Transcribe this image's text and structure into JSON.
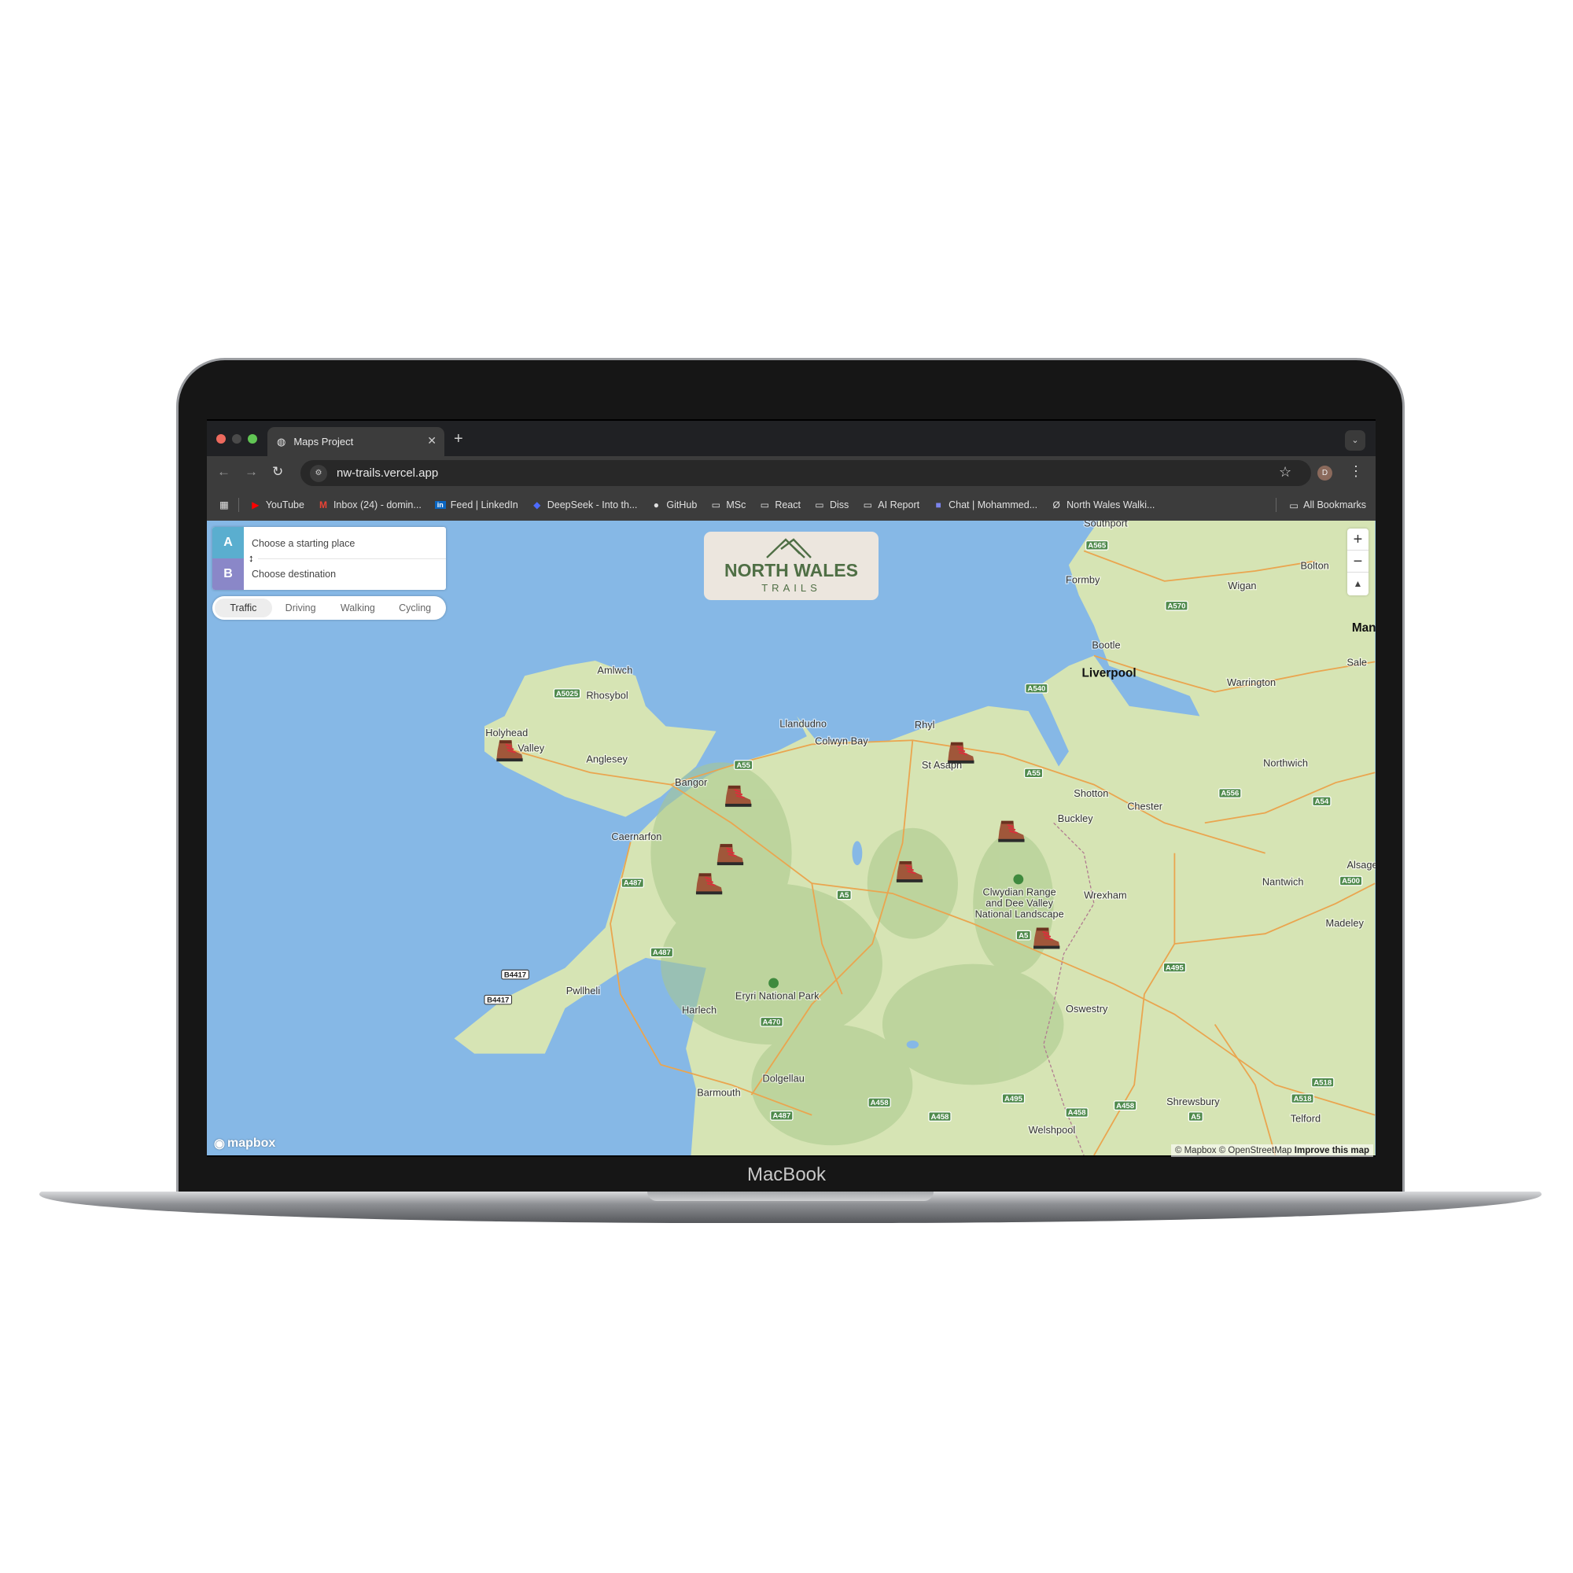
{
  "browser": {
    "tab_title": "Maps Project",
    "url": "nw-trails.vercel.app",
    "avatar_initial": "D",
    "bookmarks": [
      "YouTube",
      "Inbox (24) - domin...",
      "Feed | LinkedIn",
      "DeepSeek - Into th...",
      "GitHub",
      "MSc",
      "React",
      "Diss",
      "AI Report",
      "Chat | Mohammed...",
      "North Wales Walki..."
    ],
    "all_bookmarks": "All Bookmarks"
  },
  "directions": {
    "a_label": "A",
    "b_label": "B",
    "start_placeholder": "Choose a starting place",
    "dest_placeholder": "Choose destination",
    "modes": [
      "Traffic",
      "Driving",
      "Walking",
      "Cycling"
    ],
    "active_mode": "Traffic"
  },
  "logo": {
    "title": "NORTH WALES",
    "subtitle": "TRAILS"
  },
  "map": {
    "labels": [
      "Amlwch",
      "Rhosybol",
      "Holyhead",
      "Valley",
      "Anglesey",
      "Bangor",
      "Llandudno",
      "Colwyn Bay",
      "Rhyl",
      "St Asaph",
      "Caernarfon",
      "Bootle",
      "Southport",
      "Formby",
      "Wigan",
      "Bolton",
      "Sale",
      "Warrington",
      "Northwich",
      "Shotton",
      "Chester",
      "Buckley",
      "Wrexham",
      "Nantwich",
      "Alsager",
      "Madeley",
      "Oswestry",
      "Eryri National Park",
      "Harlech",
      "Pwllheli",
      "Dolgellau",
      "Barmouth",
      "Shrewsbury",
      "Welshpool",
      "Telford"
    ],
    "major_labels": [
      "Liverpool",
      "Man"
    ],
    "park_label": [
      "Clwydian Range",
      "and Dee Valley",
      "National Landscape"
    ],
    "roads": [
      "A5025",
      "A55",
      "A487",
      "A487",
      "A5",
      "A5",
      "A565",
      "A570",
      "A540",
      "A55",
      "A556",
      "A54",
      "A500",
      "A495",
      "A470",
      "A495",
      "A458",
      "A458",
      "A458",
      "A458",
      "A487",
      "A518",
      "A518",
      "A5"
    ],
    "b_roads": [
      "B4417",
      "B4417"
    ],
    "trail_marker_icon": "hiking-boot-icon",
    "zoom_in": "+",
    "zoom_out": "−",
    "compass": "▲",
    "brand": "mapbox",
    "attribution": "© Mapbox © OpenStreetMap",
    "improve": "Improve this map"
  },
  "device_label": "MacBook",
  "colors": {
    "sea": "#86b8e6",
    "land": "#d4e3b2",
    "a_badge": "#5aaecf",
    "b_badge": "#8a87c8",
    "logo_green": "#4f6f45"
  }
}
